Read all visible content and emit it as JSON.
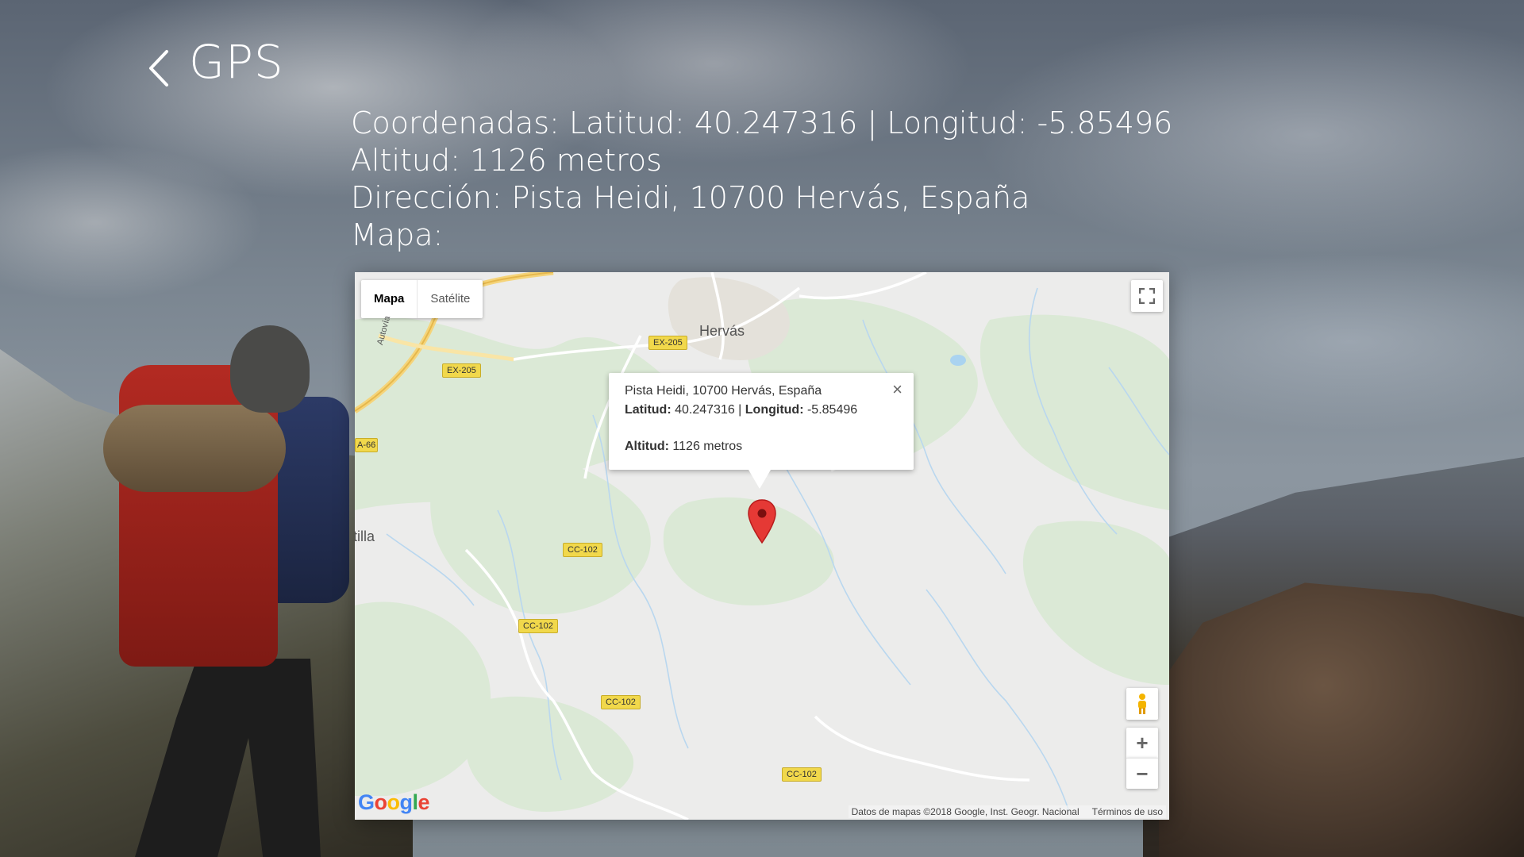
{
  "header": {
    "back_icon": "chevron-left-icon",
    "title": "GPS"
  },
  "info": {
    "coords": "Coordenadas: Latitud: 40.247316 | Longitud: -5.85496",
    "altitude": "Altitud: 1126 metros",
    "address": "Dirección: Pista Heidi, 10700 Hervás, España",
    "map_label": "Mapa:"
  },
  "map": {
    "type_buttons": [
      "Mapa",
      "Satélite"
    ],
    "selected_type": "Mapa",
    "town": "Hervás",
    "partial_town": "tilla",
    "roads": [
      "EX-205",
      "EX-205",
      "A-66",
      "CC-102",
      "CC-102",
      "CC-102",
      "CC-102"
    ],
    "motorway_label": "Autovía",
    "infowindow": {
      "address": "Pista Heidi, 10700 Hervás, España",
      "lat_label": "Latitud:",
      "lat_value": " 40.247316 | ",
      "lon_label": "Longitud:",
      "lon_value": " -5.85496",
      "alt_label": "Altitud:",
      "alt_value": " 1126 metros",
      "close": "×"
    },
    "logo": "Google",
    "attribution": "Datos de mapas ©2018 Google, Inst. Geogr. Nacional",
    "terms": "Términos de uso",
    "zoom_in": "+",
    "zoom_out": "−",
    "colors": {
      "marker": "#e53935",
      "road_label": "#f1d84b",
      "forest": "#dbe9d6"
    }
  }
}
